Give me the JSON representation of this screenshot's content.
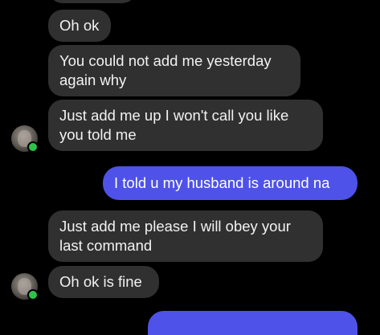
{
  "messages": [
    {
      "id": "m1",
      "text": "Oh ok"
    },
    {
      "id": "m2",
      "text": "You could not add me yesterday again why"
    },
    {
      "id": "m3",
      "text": "Just add me up I won't call you like you told me"
    },
    {
      "id": "m4",
      "text": "I told u my husband is around na"
    },
    {
      "id": "m5",
      "text": "Just add me please I will obey your last command"
    },
    {
      "id": "m6",
      "text": "Oh ok is fine"
    }
  ],
  "colors": {
    "background": "#000000",
    "incoming_bubble": "#303030",
    "outgoing_bubble": "#4e52e8",
    "online_dot": "#2fc24a"
  },
  "icons": [
    "contact-avatar-icon",
    "online-status-icon"
  ]
}
